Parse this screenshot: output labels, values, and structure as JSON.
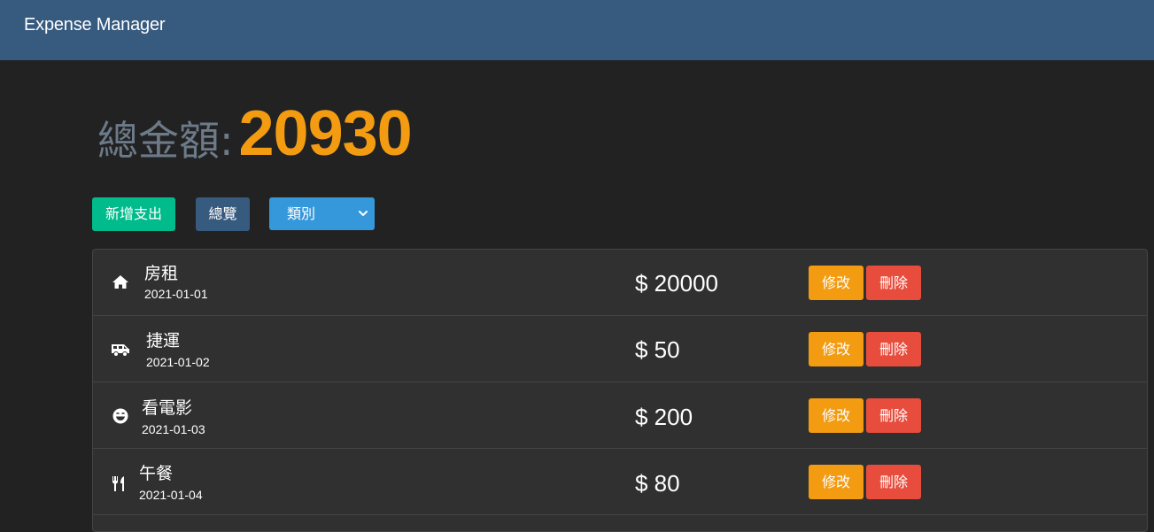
{
  "navbar": {
    "brand": "Expense Manager"
  },
  "summary": {
    "label": "總金額:",
    "total": "20930"
  },
  "toolbar": {
    "add_label": "新增支出",
    "overview_label": "總覽",
    "category_select": "類別"
  },
  "expenses": [
    {
      "icon": "home-icon",
      "name": "房租",
      "date": "2021-01-01",
      "amount": "$ 20000",
      "edit": "修改",
      "delete": "刪除"
    },
    {
      "icon": "shuttle-van-icon",
      "name": "捷運",
      "date": "2021-01-02",
      "amount": "$ 50",
      "edit": "修改",
      "delete": "刪除"
    },
    {
      "icon": "laugh-icon",
      "name": "看電影",
      "date": "2021-01-03",
      "amount": "$ 200",
      "edit": "修改",
      "delete": "刪除"
    },
    {
      "icon": "utensils-icon",
      "name": "午餐",
      "date": "2021-01-04",
      "amount": "$ 80",
      "edit": "修改",
      "delete": "刪除"
    }
  ],
  "colors": {
    "navbar": "#375a7f",
    "background": "#222222",
    "total_value": "#f39c12",
    "add_button": "#00bc8c",
    "select": "#3498db",
    "edit_button": "#f39c12",
    "delete_button": "#e74c3c"
  }
}
